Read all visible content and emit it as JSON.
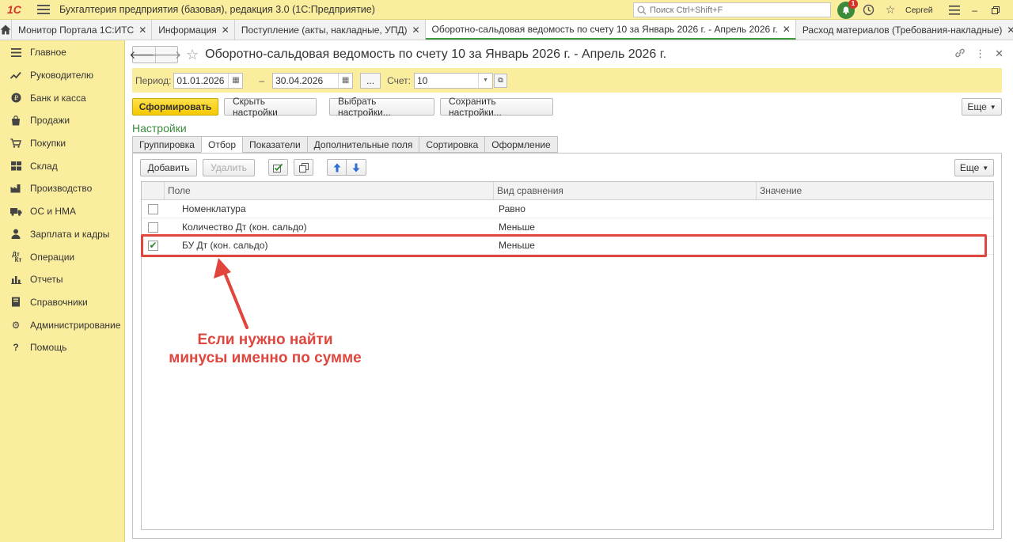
{
  "titlebar": {
    "logo": "1С",
    "app_title": "Бухгалтерия предприятия (базовая), редакция 3.0  (1С:Предприятие)",
    "search_placeholder": "Поиск Ctrl+Shift+F",
    "notifications_count": "1",
    "user_name": "Сергей"
  },
  "tabs": [
    {
      "label": "Монитор Портала 1С:ИТС",
      "active": false
    },
    {
      "label": "Информация",
      "active": false
    },
    {
      "label": "Поступление (акты, накладные, УПД)",
      "active": false
    },
    {
      "label": "Оборотно-сальдовая ведомость по счету 10 за Январь 2026 г. - Апрель 2026 г.",
      "active": true
    },
    {
      "label": "Расход материалов (Требования-накладные)",
      "active": false
    }
  ],
  "sidebar": {
    "items": [
      {
        "label": "Главное",
        "icon": "menu-icon"
      },
      {
        "label": "Руководителю",
        "icon": "trend-icon"
      },
      {
        "label": "Банк и касса",
        "icon": "coin-icon"
      },
      {
        "label": "Продажи",
        "icon": "bag-icon"
      },
      {
        "label": "Покупки",
        "icon": "cart-icon"
      },
      {
        "label": "Склад",
        "icon": "warehouse-icon"
      },
      {
        "label": "Производство",
        "icon": "factory-icon"
      },
      {
        "label": "ОС и НМА",
        "icon": "truck-icon"
      },
      {
        "label": "Зарплата и кадры",
        "icon": "person-icon"
      },
      {
        "label": "Операции",
        "icon": "dt-kt-icon"
      },
      {
        "label": "Отчеты",
        "icon": "bar-chart-icon"
      },
      {
        "label": "Справочники",
        "icon": "book-icon"
      },
      {
        "label": "Администрирование",
        "icon": "gear-icon"
      },
      {
        "label": "Помощь",
        "icon": "question-icon"
      }
    ]
  },
  "form": {
    "title": "Оборотно-сальдовая ведомость по счету 10 за Январь 2026 г. - Апрель 2026 г.",
    "period_label": "Период:",
    "date_from": "01.01.2026",
    "date_sep": "–",
    "date_to": "30.04.2026",
    "dots": "...",
    "account_label": "Счет:",
    "account_value": "10"
  },
  "commands": {
    "generate": "Сформировать",
    "hide_settings": "Скрыть настройки",
    "choose_settings": "Выбрать настройки...",
    "save_settings": "Сохранить настройки...",
    "more": "Еще"
  },
  "settings": {
    "label": "Настройки",
    "tabs": [
      "Группировка",
      "Отбор",
      "Показатели",
      "Дополнительные поля",
      "Сортировка",
      "Оформление"
    ],
    "active_tab": "Отбор",
    "add": "Добавить",
    "delete": "Удалить",
    "more": "Еще",
    "columns": [
      "Поле",
      "Вид сравнения",
      "Значение"
    ],
    "rows": [
      {
        "checked": false,
        "field": "Номенклатура",
        "comparison": "Равно",
        "value": ""
      },
      {
        "checked": false,
        "field": "Количество Дт (кон. сальдо)",
        "comparison": "Меньше",
        "value": ""
      },
      {
        "checked": true,
        "field": "БУ Дт (кон. сальдо)",
        "comparison": "Меньше",
        "value": ""
      }
    ]
  },
  "annotation": {
    "line1": "Если нужно найти",
    "line2": "минусы именно по сумме",
    "color": "#e0463e"
  }
}
